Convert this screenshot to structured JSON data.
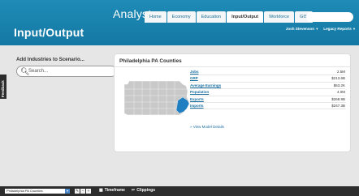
{
  "header": {
    "brand": "Analyst",
    "nav_tabs": [
      {
        "label": "Home"
      },
      {
        "label": "Economy"
      },
      {
        "label": "Education"
      },
      {
        "label": "Input/Output"
      },
      {
        "label": "Workforce"
      },
      {
        "label": "GIS"
      }
    ],
    "page_title": "Input/Output",
    "user_name": "Josh Stevenson",
    "legacy_reports": "Legacy Reports"
  },
  "left_panel": {
    "title": "Add Industries to Scenario...",
    "search_placeholder": "Search..."
  },
  "feedback_label": "Feedback",
  "card": {
    "title": "Philadelphia PA Counties",
    "metrics": [
      {
        "label": "Jobs",
        "value": "2.5M"
      },
      {
        "label": "GRP",
        "value": "$213.6B"
      },
      {
        "label": "Average Earnings",
        "value": "$63.2K"
      },
      {
        "label": "Population",
        "value": "4.0M"
      },
      {
        "label": "Exports",
        "value": "$268.9B"
      },
      {
        "label": "Imports",
        "value": "$247.3B"
      }
    ],
    "model_link": "» View Model Details",
    "map_colors": {
      "state": "#c9c9c9",
      "highlight": "#1f7fc0"
    }
  },
  "bottom_bar": {
    "region": "Philadelphia PA Counties",
    "timeframe": "Timeframe",
    "clippings": "Clippings"
  }
}
